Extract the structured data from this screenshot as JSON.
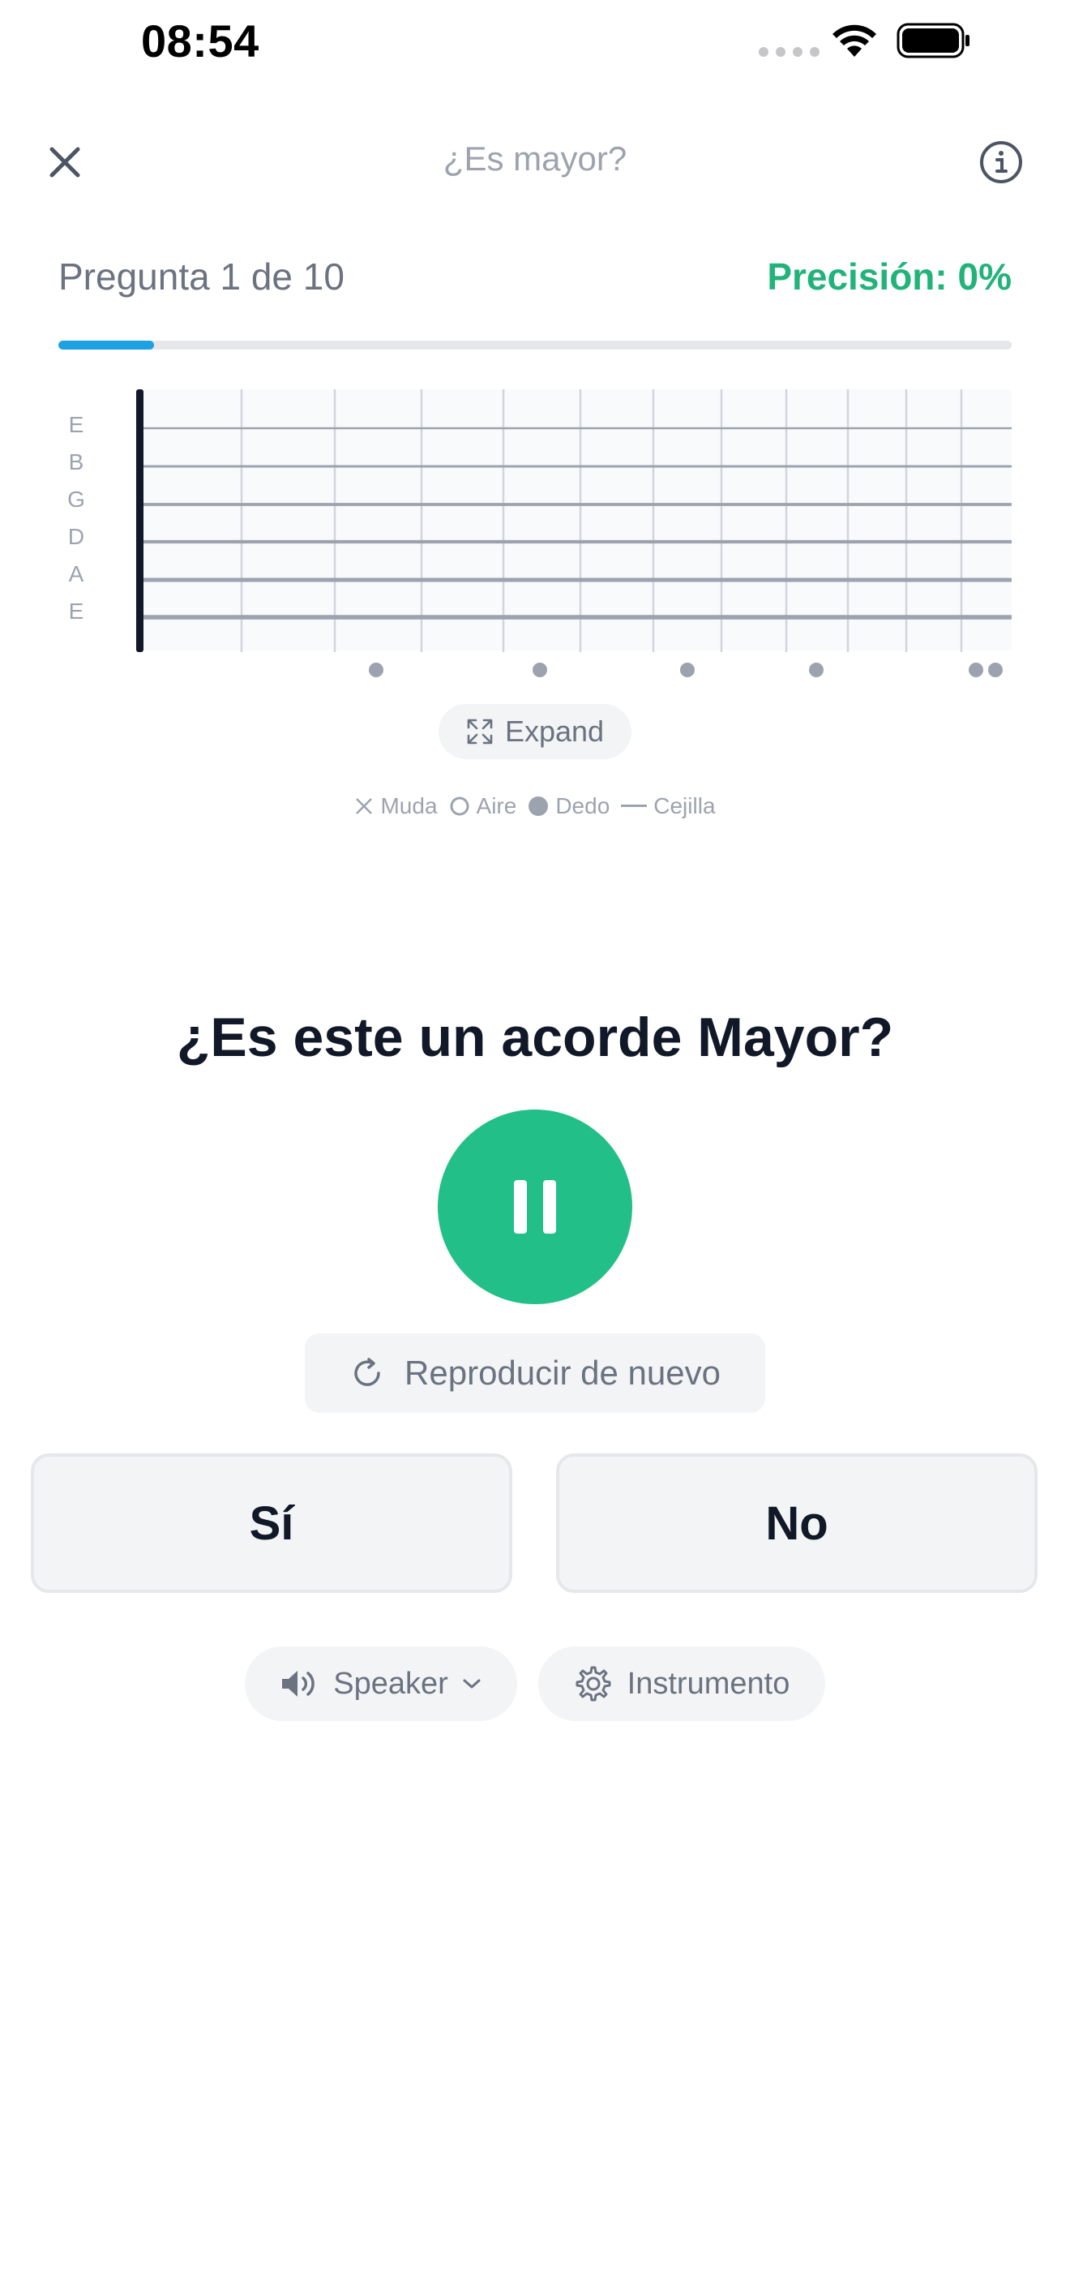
{
  "status_bar": {
    "time": "08:54"
  },
  "header": {
    "title": "¿Es mayor?",
    "close_icon": "close-icon",
    "info_icon": "info-icon"
  },
  "progress": {
    "counter": "Pregunta 1 de 10",
    "accuracy": "Precisión: 0%",
    "fraction": 0.1,
    "color": "#1ea1e1"
  },
  "fretboard": {
    "string_labels": [
      "E",
      "B",
      "G",
      "D",
      "A",
      "E"
    ],
    "expand_label": "Expand",
    "legend": {
      "muted": "Muda",
      "open": "Aire",
      "finger": "Dedo",
      "barre": "Cejilla"
    }
  },
  "question": {
    "text": "¿Es este un acorde Mayor?",
    "play_state": "pause-icon",
    "replay_label": "Reproducir de nuevo"
  },
  "answers": {
    "yes": "Sí",
    "no": "No"
  },
  "controls": {
    "speaker_label": "Speaker",
    "instrument_label": "Instrumento"
  },
  "colors": {
    "accent_green": "#22bf88",
    "accuracy_green": "#22b37a",
    "progress_blue": "#1ea1e1"
  }
}
